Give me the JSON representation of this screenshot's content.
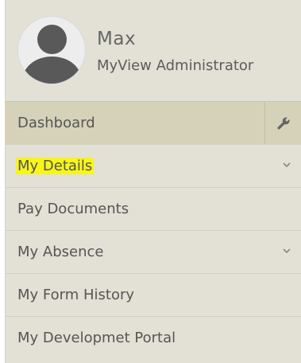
{
  "profile": {
    "name": "Max",
    "role": "MyView Administrator",
    "avatar_icon": "user-icon"
  },
  "menu": {
    "items": [
      {
        "label": "Dashboard",
        "active": true,
        "trailing_icon": "wrench-icon"
      },
      {
        "label": "My Details",
        "highlighted": true,
        "trailing_icon": "chevron-down-icon"
      },
      {
        "label": "Pay Documents"
      },
      {
        "label": "My Absence",
        "trailing_icon": "chevron-down-icon"
      },
      {
        "label": "My Form History"
      },
      {
        "label": "My Developmet Portal"
      }
    ]
  },
  "colors": {
    "panel_bg": "#e3e1d5",
    "active_bg": "#d6d1b9",
    "highlight": "#f7f51c",
    "text": "#555555"
  }
}
